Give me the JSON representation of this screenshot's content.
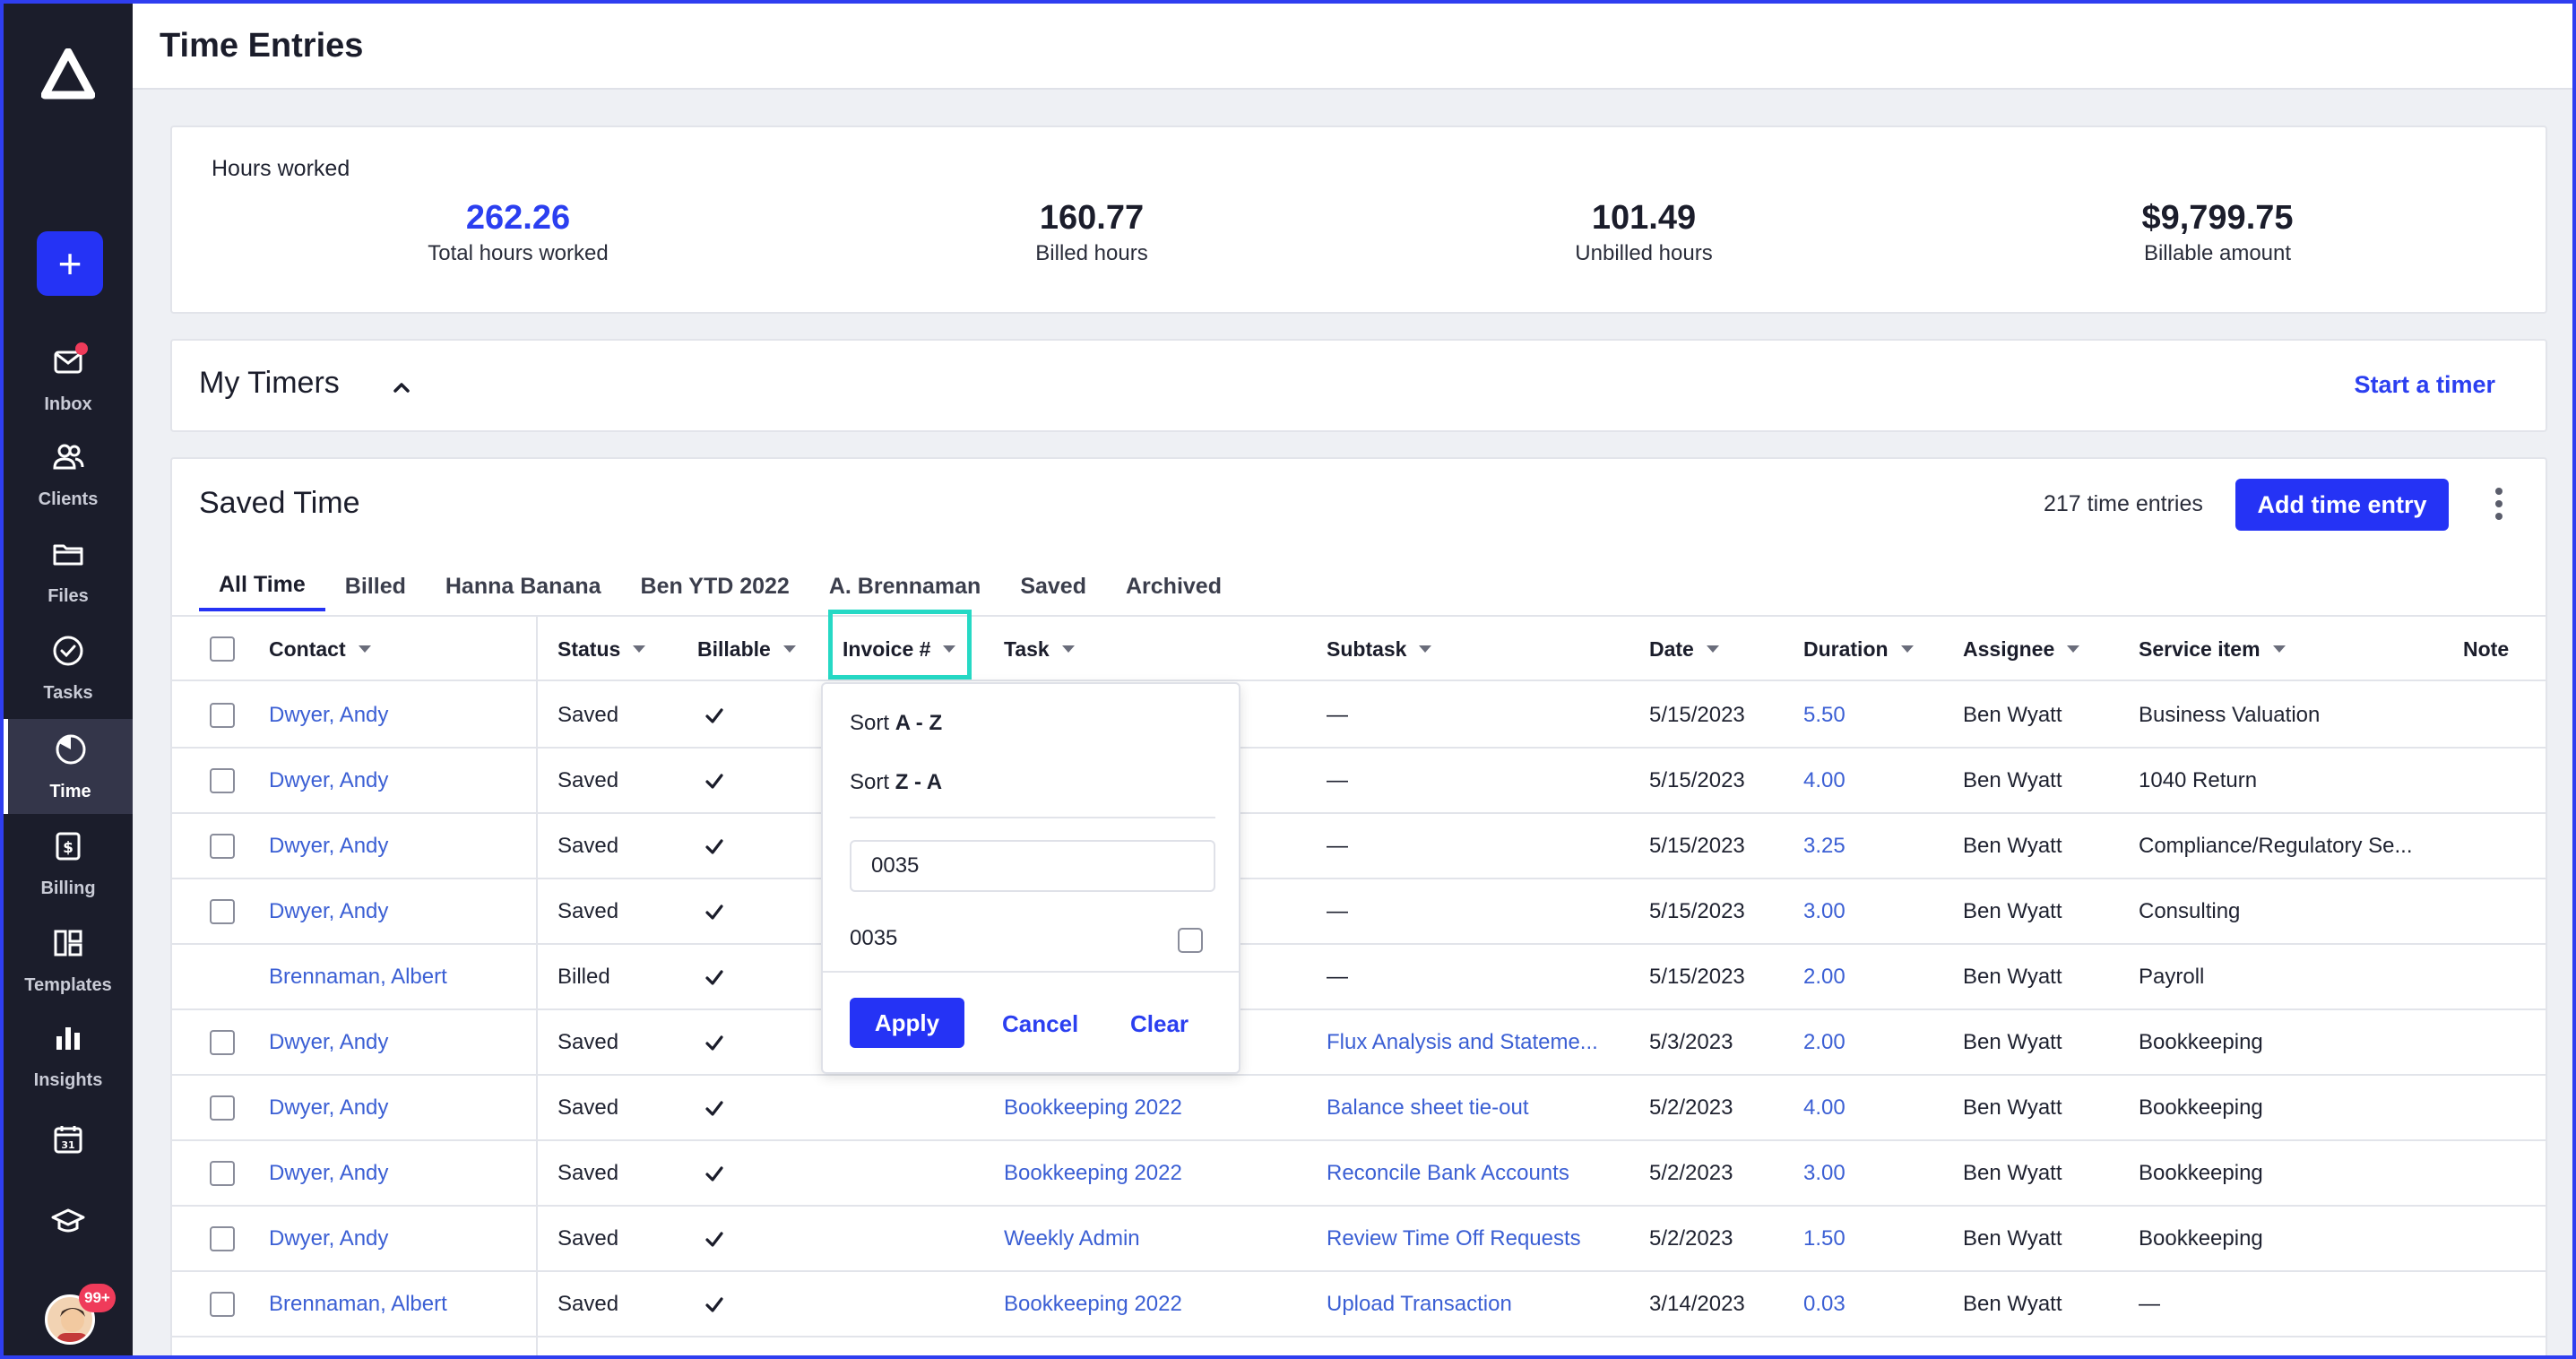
{
  "app": {
    "page_title": "Time Entries",
    "avatar_badge": "99+"
  },
  "sidebar": {
    "items": [
      {
        "label": "Inbox",
        "icon": "inbox-icon",
        "has_dot": true
      },
      {
        "label": "Clients",
        "icon": "clients-icon"
      },
      {
        "label": "Files",
        "icon": "folder-icon"
      },
      {
        "label": "Tasks",
        "icon": "check-circle-icon"
      },
      {
        "label": "Time",
        "icon": "clock-icon",
        "active": true
      },
      {
        "label": "Billing",
        "icon": "billing-icon"
      },
      {
        "label": "Templates",
        "icon": "templates-icon"
      },
      {
        "label": "Insights",
        "icon": "insights-icon"
      },
      {
        "label": "",
        "icon": "calendar-icon",
        "calendar_number": "31"
      },
      {
        "label": "",
        "icon": "graduation-cap-icon"
      }
    ]
  },
  "hours": {
    "label": "Hours worked",
    "stats": [
      {
        "value": "262.26",
        "label": "Total hours worked",
        "color": "#2b3ff0"
      },
      {
        "value": "160.77",
        "label": "Billed hours"
      },
      {
        "value": "101.49",
        "label": "Unbilled hours"
      },
      {
        "value": "$9,799.75",
        "label": "Billable amount"
      }
    ]
  },
  "timers": {
    "title": "My Timers",
    "start_label": "Start a timer"
  },
  "saved_time": {
    "title": "Saved Time",
    "entries_count": "217 time entries",
    "add_label": "Add time entry",
    "tabs": [
      "All Time",
      "Billed",
      "Hanna Banana",
      "Ben YTD 2022",
      "A. Brennaman",
      "Saved",
      "Archived"
    ],
    "columns": [
      "Contact",
      "Status",
      "Billable",
      "Invoice #",
      "Task",
      "Subtask",
      "Date",
      "Duration",
      "Assignee",
      "Service item",
      "Note"
    ],
    "rows": [
      {
        "contact": "Dwyer, Andy",
        "status": "Saved",
        "billable": true,
        "task": "",
        "subtask": "—",
        "date": "5/15/2023",
        "duration": "5.50",
        "assignee": "Ben Wyatt",
        "service": "Business Valuation",
        "checkbox": true
      },
      {
        "contact": "Dwyer, Andy",
        "status": "Saved",
        "billable": true,
        "task": "",
        "subtask": "—",
        "date": "5/15/2023",
        "duration": "4.00",
        "assignee": "Ben Wyatt",
        "service": "1040 Return",
        "checkbox": true
      },
      {
        "contact": "Dwyer, Andy",
        "status": "Saved",
        "billable": true,
        "task": "",
        "subtask": "—",
        "date": "5/15/2023",
        "duration": "3.25",
        "assignee": "Ben Wyatt",
        "service": "Compliance/Regulatory Se...",
        "checkbox": true
      },
      {
        "contact": "Dwyer, Andy",
        "status": "Saved",
        "billable": true,
        "task": "",
        "subtask": "—",
        "date": "5/15/2023",
        "duration": "3.00",
        "assignee": "Ben Wyatt",
        "service": "Consulting",
        "checkbox": true
      },
      {
        "contact": "Brennaman, Albert",
        "status": "Billed",
        "billable": true,
        "task": "",
        "subtask": "—",
        "date": "5/15/2023",
        "duration": "2.00",
        "assignee": "Ben Wyatt",
        "service": "Payroll",
        "checkbox": false
      },
      {
        "contact": "Dwyer, Andy",
        "status": "Saved",
        "billable": true,
        "task": "",
        "subtask": "Flux Analysis and Stateme...",
        "date": "5/3/2023",
        "duration": "2.00",
        "assignee": "Ben Wyatt",
        "service": "Bookkeeping",
        "checkbox": true
      },
      {
        "contact": "Dwyer, Andy",
        "status": "Saved",
        "billable": true,
        "task": "Bookkeeping 2022",
        "subtask": "Balance sheet tie-out",
        "date": "5/2/2023",
        "duration": "4.00",
        "assignee": "Ben Wyatt",
        "service": "Bookkeeping",
        "checkbox": true
      },
      {
        "contact": "Dwyer, Andy",
        "status": "Saved",
        "billable": true,
        "task": "Bookkeeping 2022",
        "subtask": "Reconcile Bank Accounts",
        "date": "5/2/2023",
        "duration": "3.00",
        "assignee": "Ben Wyatt",
        "service": "Bookkeeping",
        "checkbox": true
      },
      {
        "contact": "Dwyer, Andy",
        "status": "Saved",
        "billable": true,
        "task": "Weekly Admin",
        "subtask": "Review Time Off Requests",
        "date": "5/2/2023",
        "duration": "1.50",
        "assignee": "Ben Wyatt",
        "service": "Bookkeeping",
        "checkbox": true
      },
      {
        "contact": "Brennaman, Albert",
        "status": "Saved",
        "billable": true,
        "task": "Bookkeeping 2022",
        "subtask": "Upload Transaction",
        "date": "3/14/2023",
        "duration": "0.03",
        "assignee": "Ben Wyatt",
        "service": "—",
        "checkbox": true
      }
    ]
  },
  "invoice_filter": {
    "sort_az_prefix": "Sort ",
    "sort_az_bold": "A - Z",
    "sort_za_prefix": "Sort ",
    "sort_za_bold": "Z - A",
    "search_value": "0035",
    "option_label": "0035",
    "option_checked": false,
    "apply_label": "Apply",
    "cancel_label": "Cancel",
    "clear_label": "Clear"
  },
  "colors": {
    "accent": "#2533f5",
    "link": "#3b5fd4",
    "sidebar_bg": "#1b1d2b",
    "highlight": "#26d9c5",
    "badge": "#ef3b5a"
  }
}
